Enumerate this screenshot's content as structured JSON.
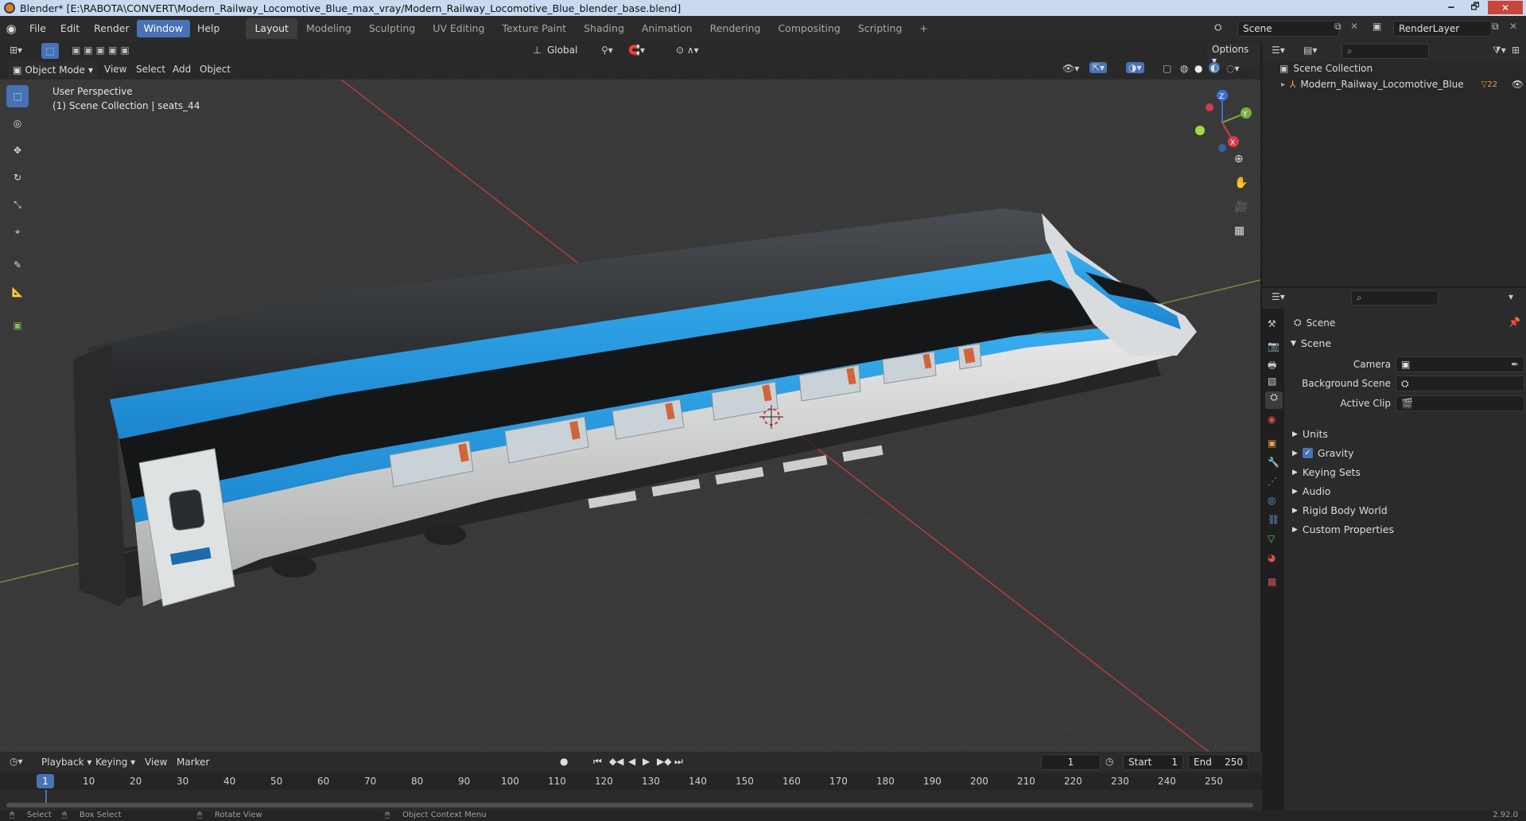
{
  "window": {
    "title": "Blender* [E:\\RABOTA\\CONVERT\\Modern_Railway_Locomotive_Blue_max_vray/Modern_Railway_Locomotive_Blue_blender_base.blend]",
    "min": "🗕",
    "max": "🗗",
    "close": "✕"
  },
  "menubar": {
    "items": [
      "File",
      "Edit",
      "Render",
      "Window",
      "Help"
    ],
    "active_item": "Window",
    "workspaces": [
      "Layout",
      "Modeling",
      "Sculpting",
      "UV Editing",
      "Texture Paint",
      "Shading",
      "Animation",
      "Rendering",
      "Compositing",
      "Scripting"
    ],
    "active_workspace": "Layout",
    "add_tab": "+",
    "scene_value": "Scene",
    "renderlayer_value": "RenderLayer"
  },
  "viewport_header": {
    "transform_orientation": "Global",
    "options_label": "Options",
    "mode": "Object Mode",
    "menus": [
      "View",
      "Select",
      "Add",
      "Object"
    ]
  },
  "viewport": {
    "perspective_label": "User Perspective",
    "collection_label": "(1) Scene Collection | seats_44",
    "gizmo_axes": [
      "Z",
      "Y",
      "X"
    ]
  },
  "outliner": {
    "root": "Scene Collection",
    "child": "Modern_Railway_Locomotive_Blue",
    "child_badge": "22"
  },
  "properties": {
    "header": "Scene",
    "panel": "Scene",
    "fields": [
      {
        "label": "Camera",
        "value": ""
      },
      {
        "label": "Background Scene",
        "value": ""
      },
      {
        "label": "Active Clip",
        "value": ""
      }
    ],
    "sections": [
      "Units",
      "Gravity",
      "Keying Sets",
      "Audio",
      "Rigid Body World",
      "Custom Properties"
    ],
    "gravity_checked": true
  },
  "timeline": {
    "menus": [
      "Playback",
      "Keying",
      "View",
      "Marker"
    ],
    "current_frame": "1",
    "start_label": "Start",
    "start_value": "1",
    "end_label": "End",
    "end_value": "250",
    "ruler": [
      "1",
      "10",
      "20",
      "30",
      "40",
      "50",
      "60",
      "70",
      "80",
      "90",
      "100",
      "110",
      "120",
      "130",
      "140",
      "150",
      "160",
      "170",
      "180",
      "190",
      "200",
      "210",
      "220",
      "230",
      "240",
      "250"
    ]
  },
  "statusbar": {
    "items": [
      "Select",
      "Box Select",
      "Rotate View",
      "Object Context Menu"
    ],
    "version": "2.92.0"
  },
  "colors": {
    "accent": "#4772b3",
    "train_blue": "#2a9de4",
    "grid_x_axis": "#c44040",
    "grid_y_axis": "#7ea23a"
  }
}
